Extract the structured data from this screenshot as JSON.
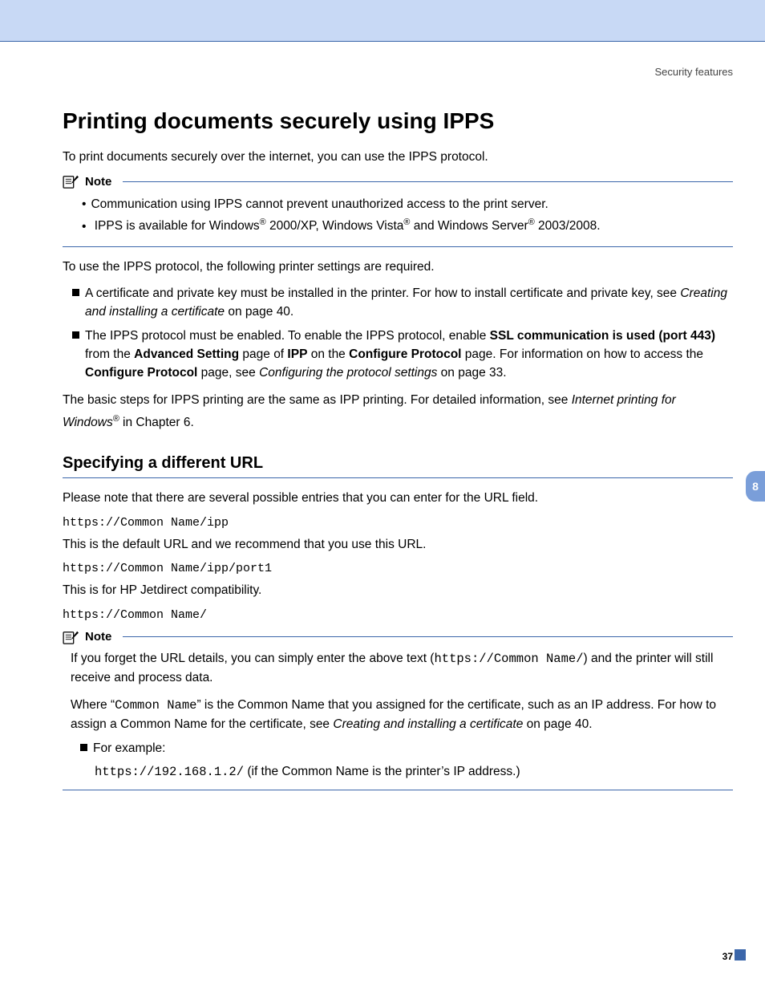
{
  "header": {
    "section_label": "Security features"
  },
  "title": "Printing documents securely using IPPS",
  "intro": "To print documents securely over the internet, you can use the IPPS protocol.",
  "note1": {
    "label": "Note",
    "items": [
      {
        "text": "Communication using IPPS cannot prevent unauthorized access to the print server."
      },
      {
        "pre": "IPPS is available for Windows",
        "sup1": "®",
        "mid1": " 2000/XP, Windows Vista",
        "sup2": "®",
        "mid2": " and Windows Server",
        "sup3": "®",
        "post": " 2003/2008."
      }
    ]
  },
  "req_intro": "To use the IPPS protocol, the following printer settings are required.",
  "req_items": [
    {
      "pre": "A certificate and private key must be installed in the printer. For how to install certificate and private key, see ",
      "link": "Creating and installing a certificate",
      "post": " on page 40."
    },
    {
      "pre": "The IPPS protocol must be enabled. To enable the IPPS protocol, enable ",
      "b1": "SSL communication is used (port 443)",
      "mid1": " from the ",
      "b2": "Advanced Setting",
      "mid2": " page of ",
      "b3": "IPP",
      "mid3": " on the ",
      "b4": "Configure Protocol",
      "mid4": " page. For information on how to access the ",
      "b5": "Configure Protocol",
      "mid5": " page, see ",
      "link": "Configuring the protocol settings",
      "post": " on page 33."
    }
  ],
  "basic": {
    "pre": "The basic steps for IPPS printing are the same as IPP printing. For detailed information, see ",
    "link": "Internet printing for Windows",
    "sup": "®",
    "post": " in Chapter 6."
  },
  "h2": "Specifying a different URL",
  "url_intro": "Please note that there are several possible entries that you can enter for the URL field.",
  "url1": "https://Common Name/ipp",
  "url1_desc": "This is the default URL and we recommend that you use this URL.",
  "url2": "https://Common Name/ipp/port1",
  "url2_desc": "This is for HP Jetdirect compatibility.",
  "url3": "https://Common Name/",
  "note2": {
    "label": "Note",
    "p1_pre": "If you forget the URL details, you can simply enter the above text (",
    "p1_code": "https://Common Name/",
    "p1_post": ") and the printer will still receive and process data.",
    "p2_pre": "Where “",
    "p2_code": "Common Name",
    "p2_mid": "” is the Common Name that you assigned for the certificate, such as an IP address. For how to assign a Common Name for the certificate, see ",
    "p2_link": "Creating and installing a certificate",
    "p2_post": " on page 40.",
    "example_label": "For example:",
    "example_code": "https://192.168.1.2/",
    "example_post": " (if the Common Name is the printer’s IP address.)"
  },
  "side_tab": "8",
  "page_number": "37"
}
